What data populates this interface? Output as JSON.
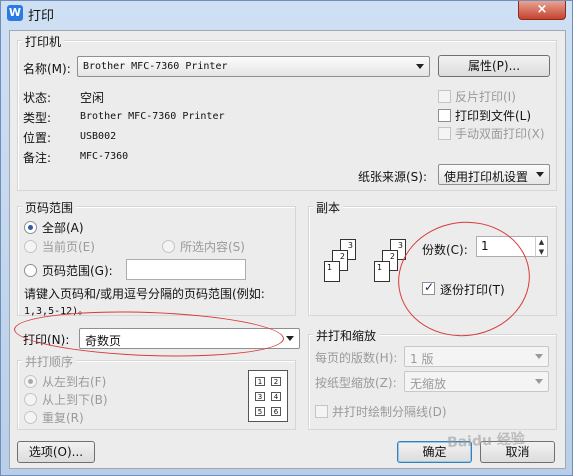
{
  "window": {
    "title": "打印",
    "close": "×"
  },
  "printer": {
    "group_label": "打印机",
    "name_label": "名称(M):",
    "name_value": "Brother MFC-7360 Printer",
    "properties_button": "属性(P)...",
    "status_label": "状态:",
    "status_value": "空闲",
    "type_label": "类型:",
    "type_value": "Brother MFC-7360 Printer",
    "location_label": "位置:",
    "location_value": "USB002",
    "comment_label": "备注:",
    "comment_value": "MFC-7360",
    "reverse_print": "反片打印(I)",
    "print_to_file": "打印到文件(L)",
    "manual_duplex": "手动双面打印(X)",
    "paper_source_label": "纸张来源(S):",
    "paper_source_value": "使用打印机设置"
  },
  "page_range": {
    "group_label": "页码范围",
    "all": "全部(A)",
    "current": "当前页(E)",
    "selection": "所选内容(S)",
    "pages": "页码范围(G):",
    "pages_value": "",
    "hint": "请键入页码和/或用逗号分隔的页码范围(例如:",
    "hint_example": "1,3,5-12)。"
  },
  "print_what": {
    "label": "打印(N):",
    "value": "奇数页"
  },
  "collate_order": {
    "group_label": "并打顺序",
    "left_right": "从左到右(F)",
    "top_bottom": "从上到下(B)",
    "repeat": "重复(R)",
    "grid": [
      "1",
      "2",
      "3",
      "4",
      "5",
      "6"
    ]
  },
  "copies": {
    "group_label": "副本",
    "copies_label": "份数(C):",
    "copies_value": "1",
    "collate": "逐份打印(T)",
    "stack_pages": [
      "3",
      "2",
      "1"
    ]
  },
  "zoom": {
    "group_label": "并打和缩放",
    "pages_per_sheet_label": "每页的版数(H):",
    "pages_per_sheet_value": "1 版",
    "scale_label": "按纸型缩放(Z):",
    "scale_value": "无缩放",
    "draw_borders": "并打时绘制分隔线(D)"
  },
  "buttons": {
    "options": "选项(O)...",
    "ok": "确定",
    "cancel": "取消"
  },
  "watermark": "Baidu 经验"
}
